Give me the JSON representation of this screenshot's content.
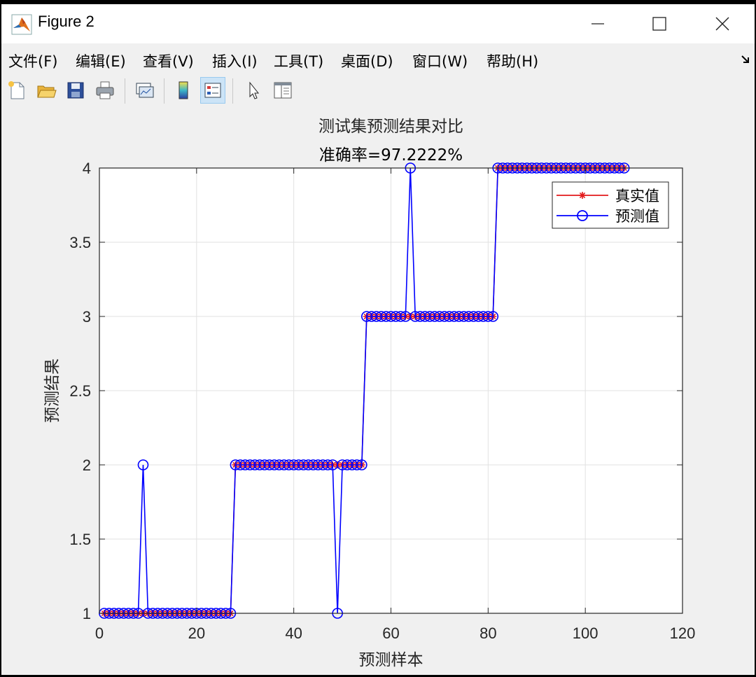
{
  "window": {
    "title": "Figure 2",
    "icons": {
      "app": "matlab-logo-icon",
      "minimize": "minimize-icon",
      "maximize": "maximize-icon",
      "close": "close-icon"
    }
  },
  "menu": {
    "items": [
      "文件(F)",
      "编辑(E)",
      "查看(V)",
      "插入(I)",
      "工具(T)",
      "桌面(D)",
      "窗口(W)",
      "帮助(H)"
    ],
    "dock_icon": "dock-arrow-icon"
  },
  "toolbar": {
    "icons": [
      "new-figure-icon",
      "open-file-icon",
      "save-icon",
      "print-icon",
      "link-plot-icon",
      "insert-colorbar-icon",
      "insert-legend-icon",
      "edit-plot-icon",
      "property-inspector-icon"
    ],
    "active": "insert-legend-icon"
  },
  "chart_data": {
    "type": "line",
    "title": "测试集预测结果对比",
    "subtitle": "准确率=97.2222%",
    "xlabel": "预测样本",
    "ylabel": "预测结果",
    "xlim": [
      0,
      120
    ],
    "ylim": [
      1,
      4
    ],
    "xticks": [
      0,
      20,
      40,
      60,
      80,
      100,
      120
    ],
    "yticks": [
      1,
      1.5,
      2,
      2.5,
      3,
      3.5,
      4
    ],
    "xtick_labels": [
      "0",
      "20",
      "40",
      "60",
      "80",
      "100",
      "120"
    ],
    "ytick_labels": [
      "1",
      "1.5",
      "2",
      "2.5",
      "3",
      "3.5",
      "4"
    ],
    "grid": true,
    "legend_position": "top-right",
    "colors": {
      "true": "#e31a1c",
      "pred": "#0000ff"
    },
    "x": [
      1,
      2,
      3,
      4,
      5,
      6,
      7,
      8,
      9,
      10,
      11,
      12,
      13,
      14,
      15,
      16,
      17,
      18,
      19,
      20,
      21,
      22,
      23,
      24,
      25,
      26,
      27,
      28,
      29,
      30,
      31,
      32,
      33,
      34,
      35,
      36,
      37,
      38,
      39,
      40,
      41,
      42,
      43,
      44,
      45,
      46,
      47,
      48,
      49,
      50,
      51,
      52,
      53,
      54,
      55,
      56,
      57,
      58,
      59,
      60,
      61,
      62,
      63,
      64,
      65,
      66,
      67,
      68,
      69,
      70,
      71,
      72,
      73,
      74,
      75,
      76,
      77,
      78,
      79,
      80,
      81,
      82,
      83,
      84,
      85,
      86,
      87,
      88,
      89,
      90,
      91,
      92,
      93,
      94,
      95,
      96,
      97,
      98,
      99,
      100,
      101,
      102,
      103,
      104,
      105,
      106,
      107,
      108
    ],
    "series": [
      {
        "name": "真实值",
        "marker": "*",
        "values": [
          1,
          1,
          1,
          1,
          1,
          1,
          1,
          1,
          1,
          1,
          1,
          1,
          1,
          1,
          1,
          1,
          1,
          1,
          1,
          1,
          1,
          1,
          1,
          1,
          1,
          1,
          1,
          2,
          2,
          2,
          2,
          2,
          2,
          2,
          2,
          2,
          2,
          2,
          2,
          2,
          2,
          2,
          2,
          2,
          2,
          2,
          2,
          2,
          2,
          2,
          2,
          2,
          2,
          2,
          3,
          3,
          3,
          3,
          3,
          3,
          3,
          3,
          3,
          3,
          3,
          3,
          3,
          3,
          3,
          3,
          3,
          3,
          3,
          3,
          3,
          3,
          3,
          3,
          3,
          3,
          3,
          4,
          4,
          4,
          4,
          4,
          4,
          4,
          4,
          4,
          4,
          4,
          4,
          4,
          4,
          4,
          4,
          4,
          4,
          4,
          4,
          4,
          4,
          4,
          4,
          4,
          4,
          4
        ]
      },
      {
        "name": "预测值",
        "marker": "o",
        "values": [
          1,
          1,
          1,
          1,
          1,
          1,
          1,
          1,
          2,
          1,
          1,
          1,
          1,
          1,
          1,
          1,
          1,
          1,
          1,
          1,
          1,
          1,
          1,
          1,
          1,
          1,
          1,
          2,
          2,
          2,
          2,
          2,
          2,
          2,
          2,
          2,
          2,
          2,
          2,
          2,
          2,
          2,
          2,
          2,
          2,
          2,
          2,
          2,
          1,
          2,
          2,
          2,
          2,
          2,
          3,
          3,
          3,
          3,
          3,
          3,
          3,
          3,
          3,
          4,
          3,
          3,
          3,
          3,
          3,
          3,
          3,
          3,
          3,
          3,
          3,
          3,
          3,
          3,
          3,
          3,
          3,
          4,
          4,
          4,
          4,
          4,
          4,
          4,
          4,
          4,
          4,
          4,
          4,
          4,
          4,
          4,
          4,
          4,
          4,
          4,
          4,
          4,
          4,
          4,
          4,
          4,
          4,
          4
        ]
      }
    ]
  }
}
